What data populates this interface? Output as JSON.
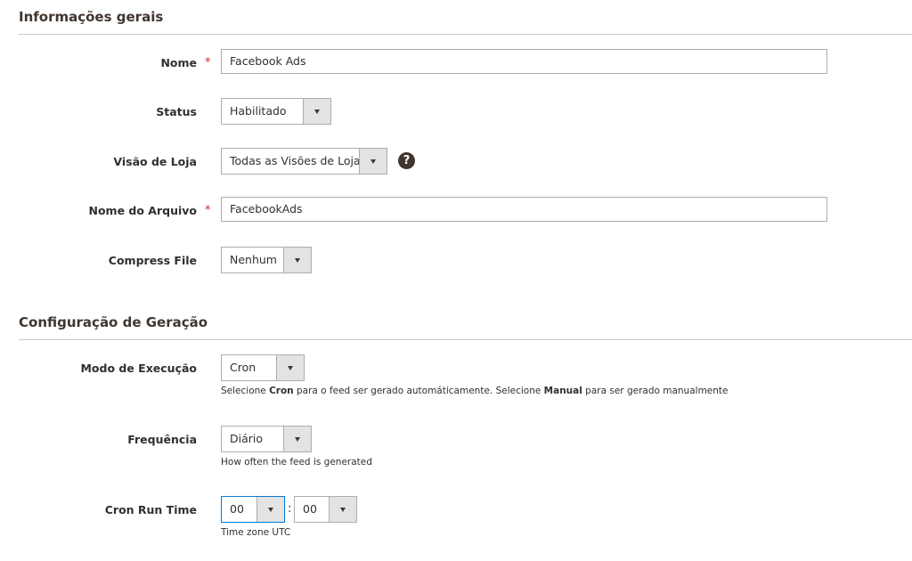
{
  "sections": {
    "general_title": "Informações gerais",
    "generation_title": "Configuração de Geração"
  },
  "fields": {
    "name": {
      "label": "Nome",
      "required_mark": "*",
      "value": "Facebook Ads"
    },
    "status": {
      "label": "Status",
      "selected": "Habilitado"
    },
    "store_view": {
      "label": "Visão de Loja",
      "selected": "Todas as Visões de Loja",
      "help_icon": "question-circle-icon"
    },
    "file_name": {
      "label": "Nome do Arquivo",
      "required_mark": "*",
      "value": "FacebookAds"
    },
    "compress": {
      "label": "Compress File",
      "selected": "Nenhum"
    },
    "execution_mode": {
      "label": "Modo de Execução",
      "selected": "Cron",
      "note_prefix": "Selecione ",
      "note_cron": "Cron",
      "note_middle": " para o feed ser gerado automáticamente. Selecione ",
      "note_manual": "Manual",
      "note_suffix": " para ser gerado manualmente"
    },
    "frequency": {
      "label": "Frequência",
      "selected": "Diário",
      "note": "How often the feed is generated"
    },
    "cron_time": {
      "label": "Cron Run Time",
      "hour": "00",
      "separator": ":",
      "minute": "00",
      "note": "Time zone UTC"
    }
  },
  "colors": {
    "accent_focus": "#007bdb",
    "required": "#e22626",
    "heading": "#41362f"
  }
}
